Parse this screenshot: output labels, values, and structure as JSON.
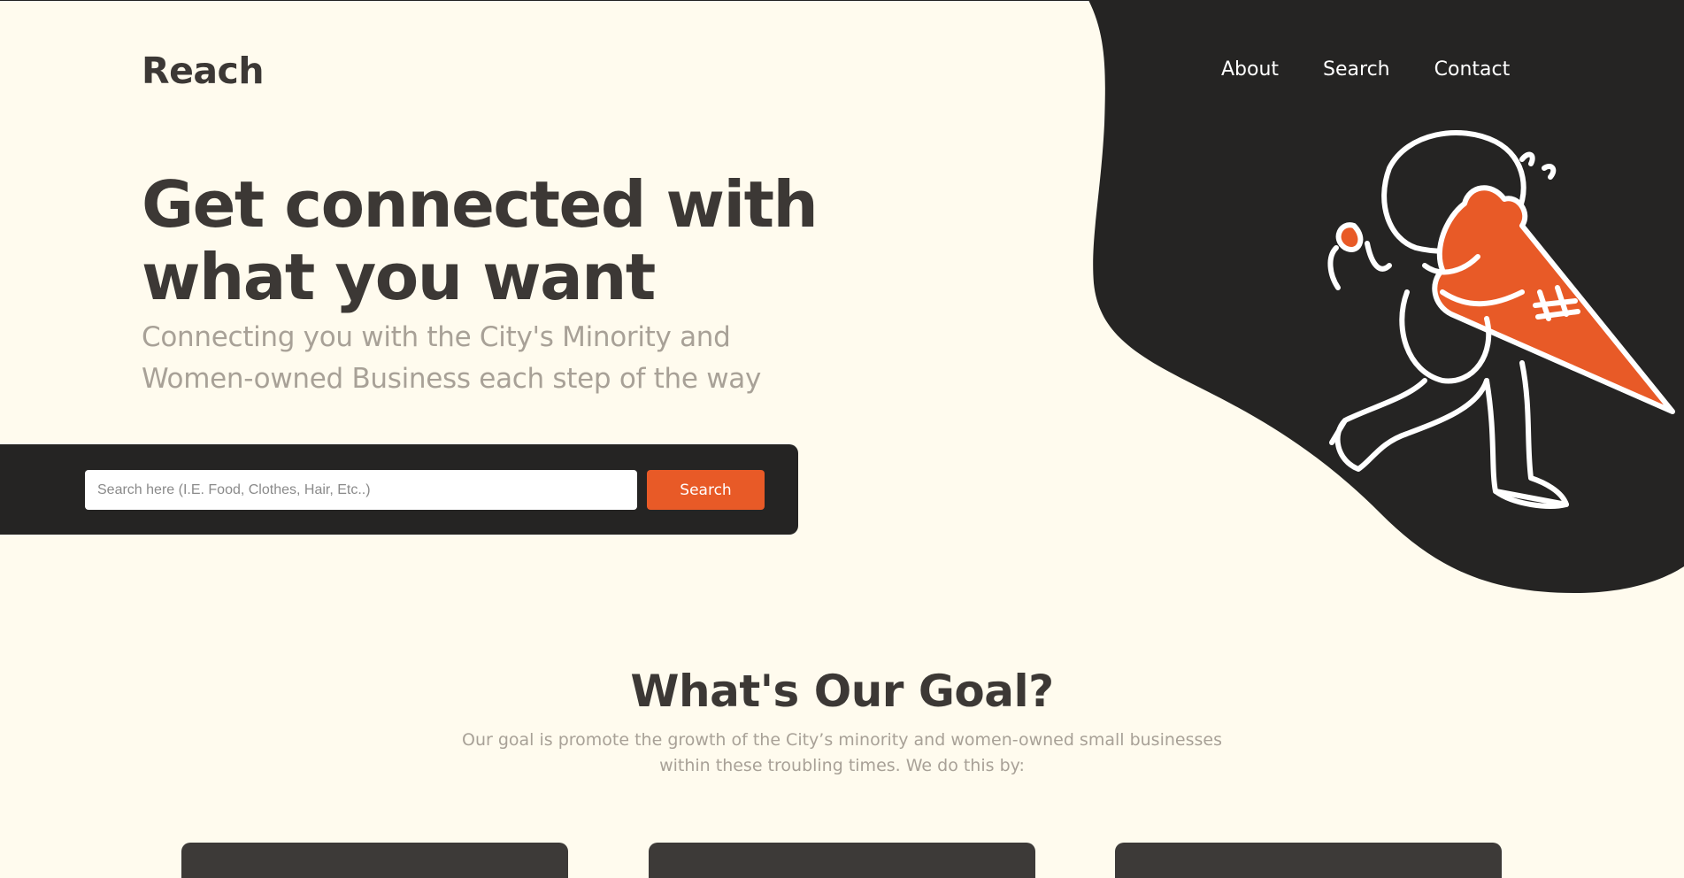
{
  "colors": {
    "background": "#fffbee",
    "dark": "#252423",
    "accent": "#e85a27",
    "heading": "#3c3835",
    "muted": "#a8a197"
  },
  "header": {
    "logo": "Reach",
    "nav": [
      {
        "label": "About"
      },
      {
        "label": "Search"
      },
      {
        "label": "Contact"
      }
    ]
  },
  "hero": {
    "title": "Get connected with what you want",
    "subtitle": "Connecting you with the City's Minority and Women-owned Business each step of the way",
    "illustration_icon": "person-carrying-ice-cream-cone-illustration"
  },
  "search": {
    "placeholder": "Search here (I.E. Food, Clothes, Hair, Etc..)",
    "value": "",
    "button_label": "Search"
  },
  "goal": {
    "title": "What's Our Goal?",
    "text": "Our goal is promote the growth of the City’s minority and women-owned small businesses within these troubling times. We do this by:"
  }
}
